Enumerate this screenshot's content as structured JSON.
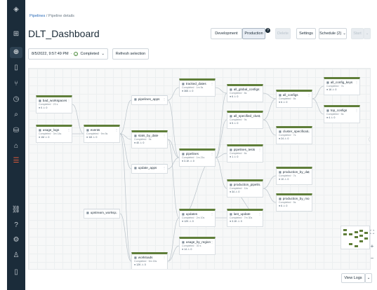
{
  "breadcrumb": {
    "root": "Pipelines",
    "sep": " / ",
    "current": "Pipeline details"
  },
  "title": "DLT_Dashboard",
  "toolbar": {
    "development": "Development",
    "production": "Production",
    "help": "?",
    "delete": "Delete",
    "settings": "Settings",
    "schedule": "Schedule (2)",
    "start": "Start"
  },
  "run": {
    "timestamp": "8/5/2022, 9:57:49 PM",
    "sep": "·",
    "status": "Completed",
    "refresh": "Refresh selection"
  },
  "nodes": [
    {
      "id": "bad_workspaces",
      "name": "bad_workspaces",
      "status": "Completed · 23 s",
      "metrics": "● 0  ⚠ 0"
    },
    {
      "id": "usage_logs",
      "name": "usage_logs",
      "status": "Completed · 3m 14s",
      "metrics": "● 1M  ⚠ 0"
    },
    {
      "id": "events",
      "name": "events",
      "status": "Completed · 9m 5s",
      "metrics": "● 1M  ⚠ 0"
    },
    {
      "id": "pipelines_apps",
      "name": "pipelines_apps",
      "status": "",
      "metrics": ""
    },
    {
      "id": "stats_by_date",
      "name": "stats_by_date",
      "status": "Completed · 9s",
      "metrics": "● 40  ⚠ 0"
    },
    {
      "id": "update_apps",
      "name": "update_apps",
      "status": "",
      "metrics": ""
    },
    {
      "id": "tracked_dates",
      "name": "tracked_dates",
      "status": "Completed · 1m 5s",
      "metrics": "● 365  ⚠ 0"
    },
    {
      "id": "pipelines",
      "name": "pipelines",
      "status": "Completed · 1m 21s",
      "metrics": "● 3.1K  ⚠ 0"
    },
    {
      "id": "all_global_configs",
      "name": "all_global_configs",
      "status": "Completed · 8s",
      "metrics": "● 6  ⚠ 0"
    },
    {
      "id": "all_specified_clust",
      "name": "all_specified_clust...",
      "status": "Completed · 9s",
      "metrics": "● 5  ⚠ 0"
    },
    {
      "id": "pipelines_tests",
      "name": "pipelines_tests",
      "status": "Completed · 6s",
      "metrics": "● 1  ⚠ 0"
    },
    {
      "id": "production_pipelines",
      "name": "production_pipelin...",
      "status": "Completed · 11s",
      "metrics": "● 34  ⚠ 0"
    },
    {
      "id": "all_configs",
      "name": "all_configs",
      "status": "Completed · 8s",
      "metrics": "● 6  ⚠ 0"
    },
    {
      "id": "cluster_specifications",
      "name": "cluster_specificati...",
      "status": "Completed · 7s",
      "metrics": "● 24  ⚠ 0"
    },
    {
      "id": "all_config_keys",
      "name": "all_config_keys",
      "status": "Completed · 7s",
      "metrics": "● 16  ⚠ 0"
    },
    {
      "id": "top_configs",
      "name": "top_configs",
      "status": "Completed · 5s",
      "metrics": "● 4  ⚠ 0"
    },
    {
      "id": "production_by_date",
      "name": "production_by_date",
      "status": "Completed · 7s",
      "metrics": "● 10  ⚠ 0"
    },
    {
      "id": "production_by_mo",
      "name": "production_by_mo...",
      "status": "Completed · 5s",
      "metrics": "● 6  ⚠ 0"
    },
    {
      "id": "updates",
      "name": "updates",
      "status": "Completed · 2m 10s",
      "metrics": "● 12K  ⚠ 0"
    },
    {
      "id": "last_update",
      "name": "last_update",
      "status": "Completed · 7m 30s",
      "metrics": "● 3.1K  ⚠ 0"
    },
    {
      "id": "usage_by_region",
      "name": "usage_by_region",
      "status": "Completed · 30 s",
      "metrics": "● 14  ⚠ 0"
    },
    {
      "id": "upstream_workspaces",
      "name": "upstream_worksp...",
      "status": "",
      "metrics": ""
    },
    {
      "id": "workloads",
      "name": "workloads",
      "status": "Completed · 5m 15s",
      "metrics": "● 12K  ⚠ 0"
    }
  ],
  "zoom": {
    "fit": "⛶",
    "in": "+",
    "out": "−"
  },
  "footer": {
    "view_logs": "View Logs",
    "chevron": "⌄"
  },
  "colors": {
    "rail": "#1b2c3a",
    "node_accent": "#5f7e39",
    "link": "#2a6bb8"
  }
}
